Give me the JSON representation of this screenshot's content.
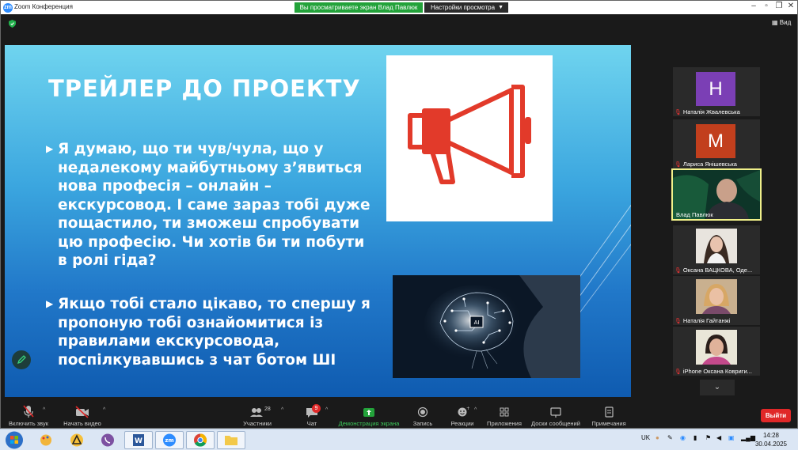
{
  "window": {
    "title": "Zoom Конференция",
    "share_banner": "Вы просматриваете экран Влад Павлюк",
    "view_settings": "Настройки просмотра",
    "view_button": "Вид"
  },
  "slide": {
    "title": "ТРЕЙЛЕР ДО ПРОЕКТУ",
    "bullets": [
      "Я думаю, що ти чув/чула, що у недалекому майбутньому з’явиться нова професія – онлайн – екскурсовод. І саме зараз тобі дуже пощастило, ти зможеш спробувати цю професію.  Чи хотів би ти побути в ролі гіда?",
      "Якщо тобі стало цікаво, то спершу я пропоную тобі ознайомитися із правилами екскурсовода, поспілкувавшись з чат ботом ШІ"
    ],
    "ai_chip_label": "AI"
  },
  "participants": [
    {
      "name": "Наталія Жвалевська",
      "initial": "Н",
      "color": "#7b3fb5"
    },
    {
      "name": "Лариса Янішевська",
      "initial": "М",
      "color": "#c23f1d"
    },
    {
      "name": "Влад Павлюк",
      "initial": "",
      "color": ""
    },
    {
      "name": "Оксана  ВАЦКОВА, Оде...",
      "initial": "",
      "color": ""
    },
    {
      "name": "Наталія Гайтанжі",
      "initial": "",
      "color": ""
    },
    {
      "name": "iPhone Оксана Ковриги...",
      "initial": "",
      "color": ""
    }
  ],
  "toolbar": {
    "mute": "Включить звук",
    "video": "Начать видео",
    "participants": "Участники",
    "participants_count": "28",
    "chat": "Чат",
    "chat_badge": "9",
    "share": "Демонстрация экрана",
    "record": "Запись",
    "reactions": "Реакции",
    "apps": "Приложения",
    "whiteboards": "Доски сообщений",
    "notes": "Примечания",
    "exit": "Выйти"
  },
  "taskbar": {
    "lang": "UK",
    "time": "14:28",
    "date": "30.04.2025"
  },
  "colors": {
    "accent_green": "#23a23a",
    "exit_red": "#e02828",
    "megaphone_red": "#e23a2a"
  }
}
